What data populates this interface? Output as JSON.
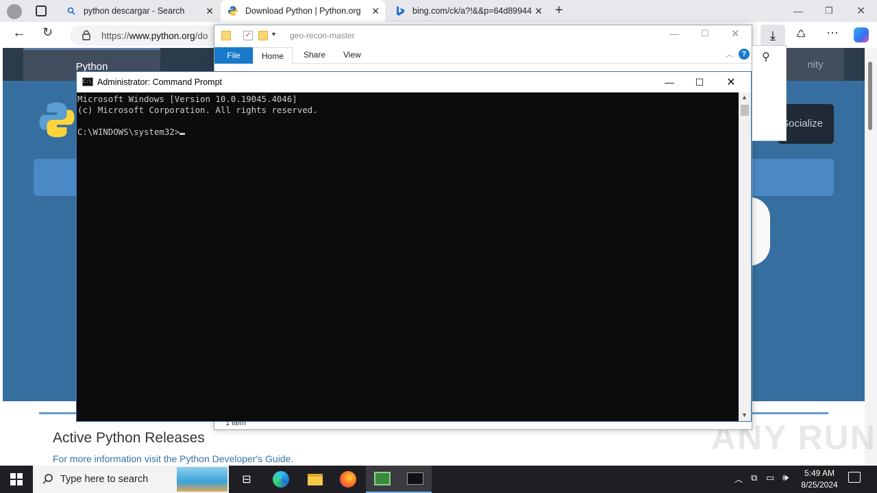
{
  "browser": {
    "tabs": [
      {
        "label": "python descargar - Search",
        "icon": "search-icon"
      },
      {
        "label": "Download Python | Python.org",
        "icon": "python-logo-icon"
      },
      {
        "label": "bing.com/ck/a?!&&p=64d89944",
        "icon": "bing-icon"
      }
    ],
    "url_prefix": "https://",
    "url_host": "www.python.org",
    "url_path": "/do"
  },
  "page": {
    "nav_python": "Python",
    "nav_community": "nity",
    "socialize": "Socialize",
    "releases_heading": "Active Python Releases",
    "dev_guide_text": "For more information visit the Python Developer's Guide."
  },
  "explorer": {
    "title": "geo-recon-master",
    "tabs": {
      "file": "File",
      "home": "Home",
      "share": "Share",
      "view": "View"
    },
    "status": "1 item"
  },
  "cmd": {
    "title": "Administrator: Command Prompt",
    "line1": "Microsoft Windows [Version 10.0.19045.4046]",
    "line2": "(c) Microsoft Corporation. All rights reserved.",
    "prompt": "C:\\WINDOWS\\system32>"
  },
  "taskbar": {
    "search_placeholder": "Type here to search",
    "time": "5:49 AM",
    "date": "8/25/2024"
  },
  "watermark": "ANY RUN",
  "colors": {
    "python_blue": "#366f9f",
    "python_dark": "#2b3b4c",
    "taskbar": "#1f1f23",
    "cmd_bg": "#0c0c0c"
  }
}
